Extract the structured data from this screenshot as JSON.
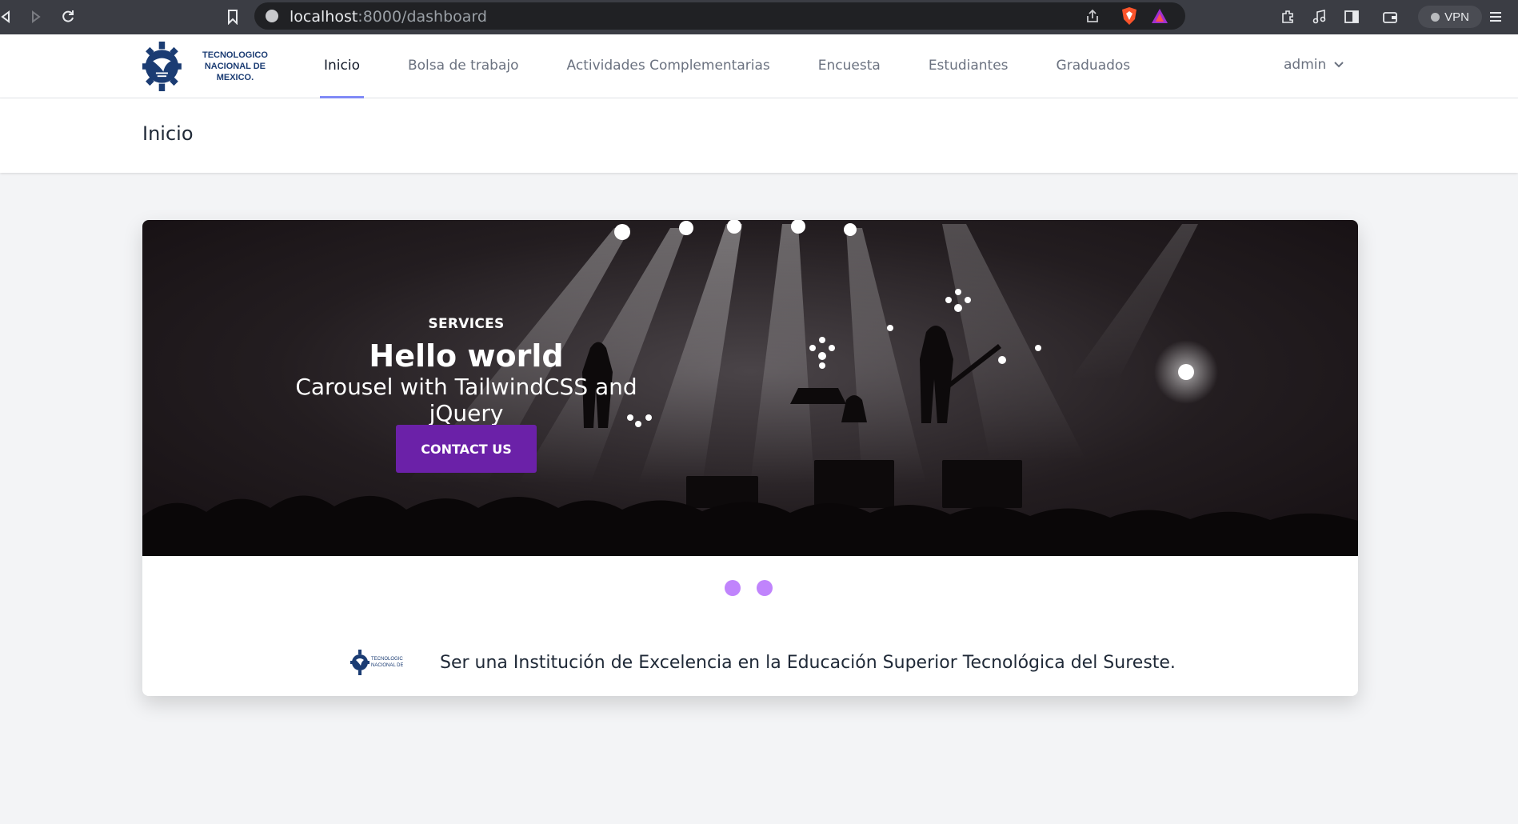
{
  "browser": {
    "url_host": "localhost",
    "url_path": ":8000/dashboard",
    "vpn_label": "VPN"
  },
  "nav": {
    "logo_text_line1": "TECNOLOGICO",
    "logo_text_line2": "NACIONAL DE MEXICO.",
    "links": [
      {
        "label": "Inicio",
        "active": true
      },
      {
        "label": "Bolsa de trabajo",
        "active": false
      },
      {
        "label": "Actividades Complementarias",
        "active": false
      },
      {
        "label": "Encuesta",
        "active": false
      },
      {
        "label": "Estudiantes",
        "active": false
      },
      {
        "label": "Graduados",
        "active": false
      }
    ],
    "user": "admin"
  },
  "page": {
    "title": "Inicio"
  },
  "carousel": {
    "kicker": "SERVICES",
    "headline": "Hello world",
    "subtitle": "Carousel with TailwindCSS and jQuery",
    "cta_label": "CONTACT US",
    "slides_count": 2,
    "indicator_color": "#c084fc",
    "cta_color": "#6b21a8"
  },
  "mission": {
    "text": "Ser una Institución de Excelencia en la Educación Superior Tecnológica del Sureste."
  },
  "colors": {
    "active_tab_underline": "#818cf8",
    "brand_blue": "#1b3c73"
  }
}
